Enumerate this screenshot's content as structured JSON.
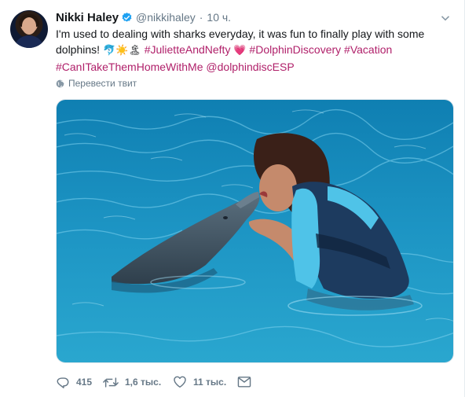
{
  "tweet": {
    "author_name": "Nikki Haley",
    "author_handle": "@nikkihaley",
    "separator": "·",
    "time": "10 ч.",
    "text_plain": "I'm used to dealing with sharks everyday, it was fun to finally play with some dolphins!",
    "emojis": "🐬☀️🏝",
    "hashtags": [
      "#JulietteAndNefty",
      "#DolphinDiscovery",
      "#Vacation",
      "#CanITakeThemHomeWithMe"
    ],
    "heart_emoji": "💗",
    "mention": "@dolphindiscESP",
    "translate_label": "Перевести твит"
  },
  "actions": {
    "reply_count": "415",
    "retweet_count": "1,6 тыс.",
    "like_count": "11 тыс."
  },
  "colors": {
    "link": "#b0206a",
    "secondary_text": "#657786",
    "verified": "#1da1f2"
  },
  "icons": {
    "verified": "verified-badge-icon",
    "caret": "chevron-down-icon",
    "translate": "globe-icon",
    "reply": "reply-icon",
    "retweet": "retweet-icon",
    "like": "heart-icon",
    "dm": "mail-icon"
  }
}
